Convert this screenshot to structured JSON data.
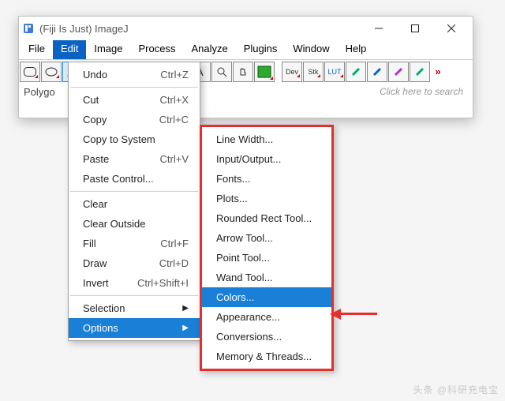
{
  "window": {
    "title": "(Fiji Is Just) ImageJ"
  },
  "menubar": [
    "File",
    "Edit",
    "Image",
    "Process",
    "Analyze",
    "Plugins",
    "Window",
    "Help"
  ],
  "menubar_open_index": 1,
  "toolbar": {
    "search_placeholder": "Click here to search",
    "tools_text": {
      "dev": "Dev",
      "stk": "Stk",
      "lut": "LUT"
    }
  },
  "statusbar": "Polygo",
  "edit_menu": {
    "groups": [
      [
        {
          "label": "Undo",
          "shortcut": "Ctrl+Z"
        }
      ],
      [
        {
          "label": "Cut",
          "shortcut": "Ctrl+X"
        },
        {
          "label": "Copy",
          "shortcut": "Ctrl+C"
        },
        {
          "label": "Copy to System",
          "shortcut": ""
        },
        {
          "label": "Paste",
          "shortcut": "Ctrl+V"
        },
        {
          "label": "Paste Control...",
          "shortcut": ""
        }
      ],
      [
        {
          "label": "Clear",
          "shortcut": ""
        },
        {
          "label": "Clear Outside",
          "shortcut": ""
        },
        {
          "label": "Fill",
          "shortcut": "Ctrl+F"
        },
        {
          "label": "Draw",
          "shortcut": "Ctrl+D"
        },
        {
          "label": "Invert",
          "shortcut": "Ctrl+Shift+I"
        }
      ],
      [
        {
          "label": "Selection",
          "submenu": true
        },
        {
          "label": "Options",
          "submenu": true,
          "highlight": true
        }
      ]
    ]
  },
  "options_menu": {
    "items": [
      {
        "label": "Line Width..."
      },
      {
        "label": "Input/Output..."
      },
      {
        "label": "Fonts..."
      },
      {
        "label": "Plots..."
      },
      {
        "label": "Rounded Rect Tool..."
      },
      {
        "label": "Arrow Tool..."
      },
      {
        "label": "Point Tool..."
      },
      {
        "label": "Wand Tool..."
      },
      {
        "label": "Colors...",
        "highlight": true
      },
      {
        "label": "Appearance..."
      },
      {
        "label": "Conversions..."
      },
      {
        "label": "Memory & Threads..."
      }
    ]
  },
  "watermark": "头条 @科研充电宝"
}
